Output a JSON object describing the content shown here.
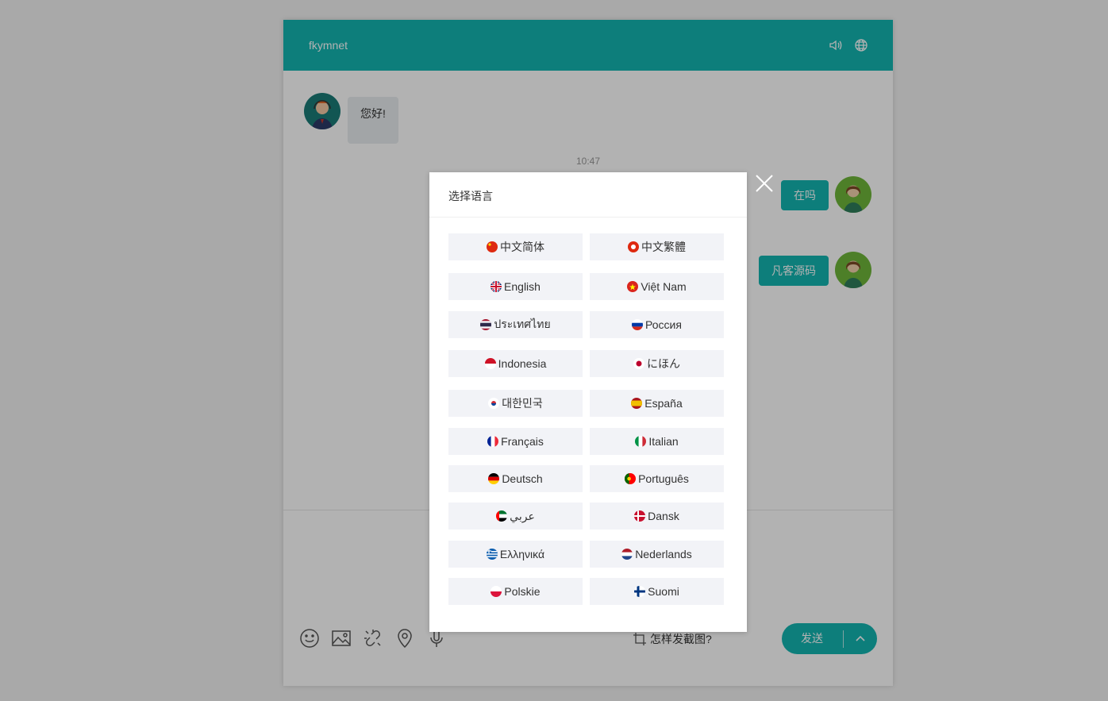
{
  "header": {
    "title": "fkymnet",
    "sound_icon": "speaker-icon",
    "language_icon": "globe-icon"
  },
  "messages": [
    {
      "from": "agent",
      "text": "您好!"
    },
    {
      "type": "time",
      "text": "10:47"
    },
    {
      "from": "user",
      "text": "在吗"
    },
    {
      "from": "user",
      "text": "凡客源码"
    }
  ],
  "toolbar": {
    "icons": [
      "emoji-icon",
      "image-icon",
      "link-icon",
      "location-icon",
      "microphone-icon"
    ],
    "screenshot_help": "怎样发截图?",
    "send_label": "发送"
  },
  "modal": {
    "title": "选择语言",
    "languages": [
      {
        "label": "中文简体",
        "flag": "cn"
      },
      {
        "label": "中文繁體",
        "flag": "hk"
      },
      {
        "label": "English",
        "flag": "gb"
      },
      {
        "label": "Việt Nam",
        "flag": "vn"
      },
      {
        "label": "ประเทศไทย",
        "flag": "th"
      },
      {
        "label": "Россия",
        "flag": "ru"
      },
      {
        "label": "Indonesia",
        "flag": "id"
      },
      {
        "label": "にほん",
        "flag": "jp"
      },
      {
        "label": "대한민국",
        "flag": "kr"
      },
      {
        "label": "España",
        "flag": "es"
      },
      {
        "label": "Français",
        "flag": "fr"
      },
      {
        "label": "Italian",
        "flag": "it"
      },
      {
        "label": "Deutsch",
        "flag": "de"
      },
      {
        "label": "Português",
        "flag": "pt"
      },
      {
        "label": "عربي",
        "flag": "ae"
      },
      {
        "label": "Dansk",
        "flag": "dk"
      },
      {
        "label": "Ελληνικά",
        "flag": "gr"
      },
      {
        "label": "Nederlands",
        "flag": "nl"
      },
      {
        "label": "Polskie",
        "flag": "pl"
      },
      {
        "label": "Suomi",
        "flag": "fi"
      }
    ]
  },
  "colors": {
    "accent": "#13b5b1",
    "overlay": "rgba(0,0,0,0.3)",
    "button_bg": "#f2f3f7"
  }
}
